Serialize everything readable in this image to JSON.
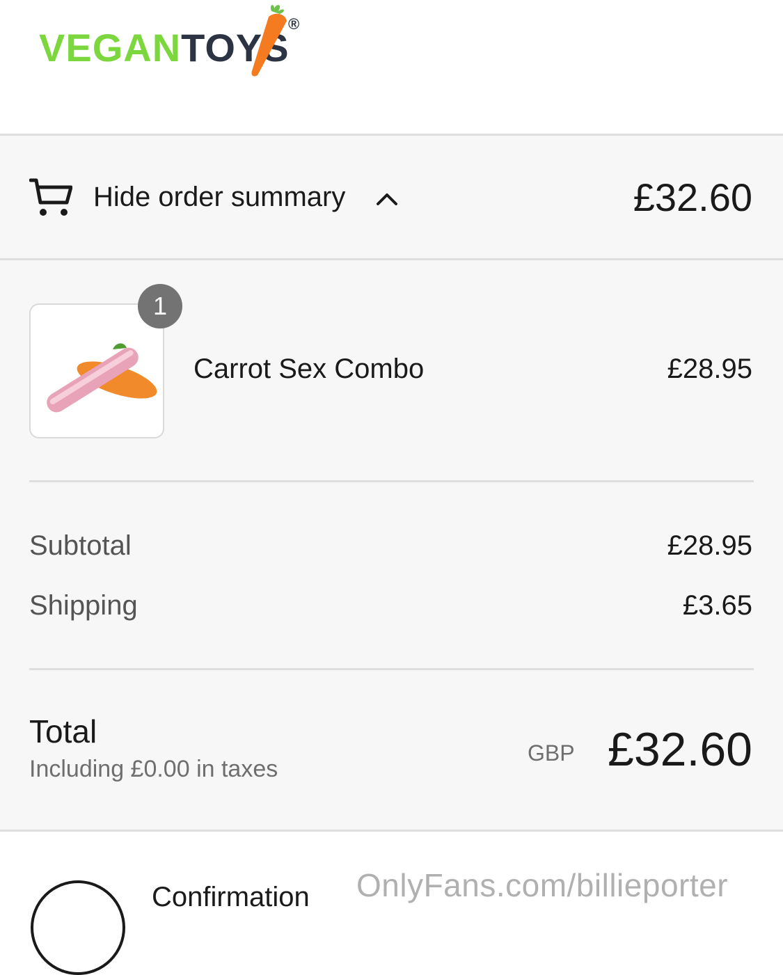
{
  "brand": {
    "name_green": "VEGAN",
    "name_navy": "TOYS",
    "registered_mark": "®",
    "colors": {
      "green": "#7cd63d",
      "navy": "#2c3443",
      "carrot": "#f47b20"
    }
  },
  "summary_bar": {
    "cart_icon": "cart-icon",
    "toggle_label": "Hide order summary",
    "chevron_icon": "chevron-up-icon",
    "total": "£32.60"
  },
  "line_items": [
    {
      "quantity": "1",
      "name": "Carrot Sex Combo",
      "price": "£28.95"
    }
  ],
  "totals": {
    "subtotal_label": "Subtotal",
    "subtotal_value": "£28.95",
    "shipping_label": "Shipping",
    "shipping_value": "£3.65",
    "total_label": "Total",
    "tax_note": "Including £0.00 in taxes",
    "currency": "GBP",
    "total_value": "£32.60"
  },
  "next_step": {
    "label": "Confirmation"
  },
  "watermark": "OnlyFans.com/billieporter"
}
